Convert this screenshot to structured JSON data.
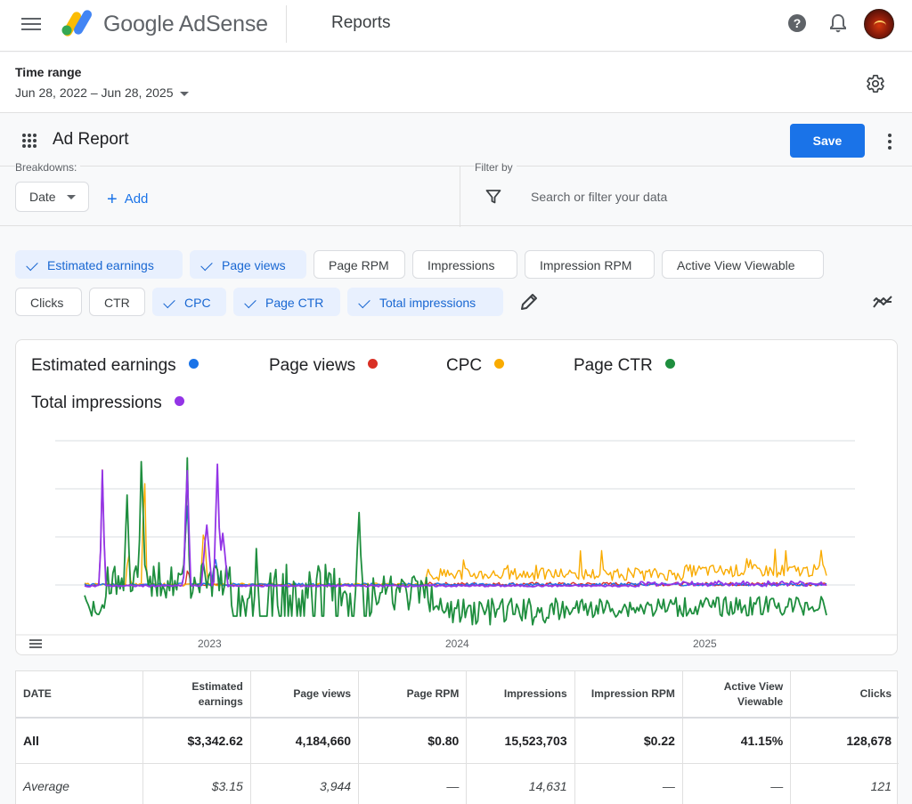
{
  "app": {
    "brand": "Google AdSense",
    "page_title": "Reports"
  },
  "time_range": {
    "label": "Time range",
    "value": "Jun 28, 2022 – Jun 28, 2025"
  },
  "report": {
    "title": "Ad Report",
    "save_label": "Save"
  },
  "breakdowns": {
    "label": "Breakdowns:",
    "date_label": "Date",
    "add_label": "Add"
  },
  "filter": {
    "label": "Filter by",
    "placeholder": "Search or filter your data"
  },
  "metrics": [
    {
      "label": "Estimated earnings",
      "selected": true
    },
    {
      "label": "Page views",
      "selected": true
    },
    {
      "label": "Page RPM",
      "selected": false
    },
    {
      "label": "Impressions",
      "selected": false
    },
    {
      "label": "Impression RPM",
      "selected": false
    },
    {
      "label": "Active View Viewable",
      "selected": false
    },
    {
      "label": "Clicks",
      "selected": false
    },
    {
      "label": "CTR",
      "selected": false
    },
    {
      "label": "CPC",
      "selected": true
    },
    {
      "label": "Page CTR",
      "selected": true
    },
    {
      "label": "Total impressions",
      "selected": true
    }
  ],
  "colors": {
    "accent": "#1a73e8",
    "earnings": "#1a73e8",
    "page_views": "#d93025",
    "cpc": "#f9ab00",
    "page_ctr": "#1e8e3e",
    "total_impressions": "#9334e6"
  },
  "chart_data": {
    "type": "line",
    "x_ticks": [
      "2023",
      "2024",
      "2025"
    ],
    "x_range": [
      "2022-06-28",
      "2025-06-28"
    ],
    "grid": true,
    "legend_position": "top",
    "series": [
      {
        "name": "Estimated earnings",
        "color": "#1a73e8"
      },
      {
        "name": "Page views",
        "color": "#d93025"
      },
      {
        "name": "CPC",
        "color": "#f9ab00"
      },
      {
        "name": "Page CTR",
        "color": "#1e8e3e"
      },
      {
        "name": "Total impressions",
        "color": "#9334e6"
      }
    ]
  },
  "table": {
    "headers": [
      "DATE",
      "Estimated earnings",
      "Page views",
      "Page RPM",
      "Impressions",
      "Impression RPM",
      "Active View Viewable",
      "Clicks"
    ],
    "rows": [
      [
        "All",
        "$3,342.62",
        "4,184,660",
        "$0.80",
        "15,523,703",
        "$0.22",
        "41.15%",
        "128,678"
      ],
      [
        "Average",
        "$3.15",
        "3,944",
        "—",
        "14,631",
        "—",
        "—",
        "121"
      ]
    ]
  }
}
